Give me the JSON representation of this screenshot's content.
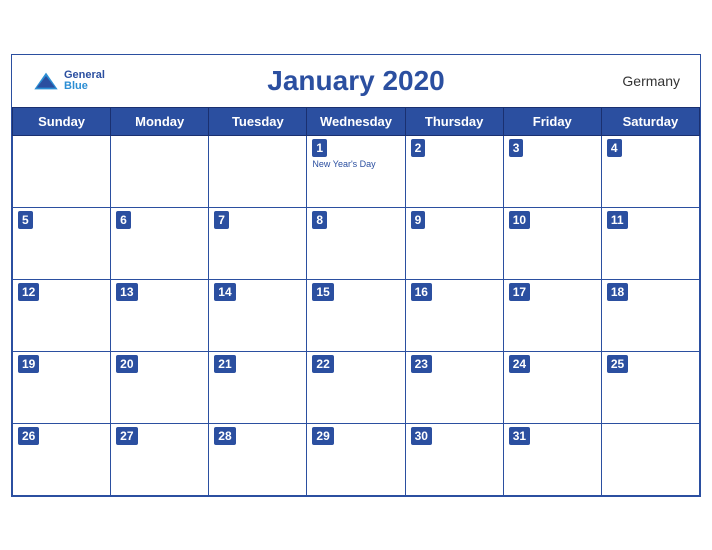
{
  "header": {
    "title": "January 2020",
    "country": "Germany",
    "logo_general": "General",
    "logo_blue": "Blue"
  },
  "weekdays": [
    "Sunday",
    "Monday",
    "Tuesday",
    "Wednesday",
    "Thursday",
    "Friday",
    "Saturday"
  ],
  "weeks": [
    [
      {
        "day": "",
        "empty": true
      },
      {
        "day": "",
        "empty": true
      },
      {
        "day": "",
        "empty": true
      },
      {
        "day": "1",
        "holiday": "New Year's Day"
      },
      {
        "day": "2"
      },
      {
        "day": "3"
      },
      {
        "day": "4"
      }
    ],
    [
      {
        "day": "5"
      },
      {
        "day": "6"
      },
      {
        "day": "7"
      },
      {
        "day": "8"
      },
      {
        "day": "9"
      },
      {
        "day": "10"
      },
      {
        "day": "11"
      }
    ],
    [
      {
        "day": "12"
      },
      {
        "day": "13"
      },
      {
        "day": "14"
      },
      {
        "day": "15"
      },
      {
        "day": "16"
      },
      {
        "day": "17"
      },
      {
        "day": "18"
      }
    ],
    [
      {
        "day": "19"
      },
      {
        "day": "20"
      },
      {
        "day": "21"
      },
      {
        "day": "22"
      },
      {
        "day": "23"
      },
      {
        "day": "24"
      },
      {
        "day": "25"
      }
    ],
    [
      {
        "day": "26"
      },
      {
        "day": "27"
      },
      {
        "day": "28"
      },
      {
        "day": "29"
      },
      {
        "day": "30"
      },
      {
        "day": "31"
      },
      {
        "day": "",
        "empty": true
      }
    ]
  ]
}
